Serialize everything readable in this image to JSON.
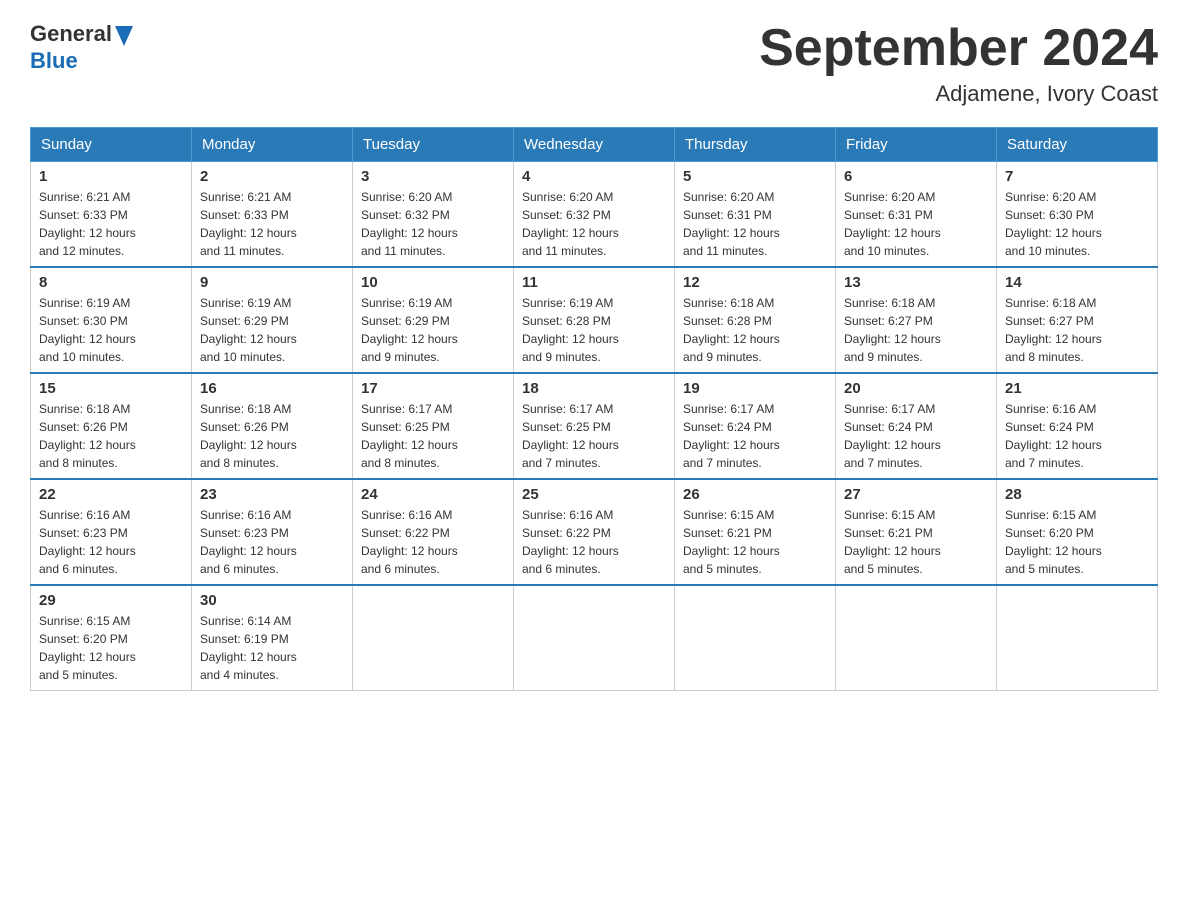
{
  "header": {
    "logo_line1": "General",
    "logo_line2": "Blue",
    "title": "September 2024",
    "subtitle": "Adjamene, Ivory Coast"
  },
  "days_of_week": [
    "Sunday",
    "Monday",
    "Tuesday",
    "Wednesday",
    "Thursday",
    "Friday",
    "Saturday"
  ],
  "weeks": [
    [
      {
        "day": "1",
        "info": "Sunrise: 6:21 AM\nSunset: 6:33 PM\nDaylight: 12 hours\nand 12 minutes."
      },
      {
        "day": "2",
        "info": "Sunrise: 6:21 AM\nSunset: 6:33 PM\nDaylight: 12 hours\nand 11 minutes."
      },
      {
        "day": "3",
        "info": "Sunrise: 6:20 AM\nSunset: 6:32 PM\nDaylight: 12 hours\nand 11 minutes."
      },
      {
        "day": "4",
        "info": "Sunrise: 6:20 AM\nSunset: 6:32 PM\nDaylight: 12 hours\nand 11 minutes."
      },
      {
        "day": "5",
        "info": "Sunrise: 6:20 AM\nSunset: 6:31 PM\nDaylight: 12 hours\nand 11 minutes."
      },
      {
        "day": "6",
        "info": "Sunrise: 6:20 AM\nSunset: 6:31 PM\nDaylight: 12 hours\nand 10 minutes."
      },
      {
        "day": "7",
        "info": "Sunrise: 6:20 AM\nSunset: 6:30 PM\nDaylight: 12 hours\nand 10 minutes."
      }
    ],
    [
      {
        "day": "8",
        "info": "Sunrise: 6:19 AM\nSunset: 6:30 PM\nDaylight: 12 hours\nand 10 minutes."
      },
      {
        "day": "9",
        "info": "Sunrise: 6:19 AM\nSunset: 6:29 PM\nDaylight: 12 hours\nand 10 minutes."
      },
      {
        "day": "10",
        "info": "Sunrise: 6:19 AM\nSunset: 6:29 PM\nDaylight: 12 hours\nand 9 minutes."
      },
      {
        "day": "11",
        "info": "Sunrise: 6:19 AM\nSunset: 6:28 PM\nDaylight: 12 hours\nand 9 minutes."
      },
      {
        "day": "12",
        "info": "Sunrise: 6:18 AM\nSunset: 6:28 PM\nDaylight: 12 hours\nand 9 minutes."
      },
      {
        "day": "13",
        "info": "Sunrise: 6:18 AM\nSunset: 6:27 PM\nDaylight: 12 hours\nand 9 minutes."
      },
      {
        "day": "14",
        "info": "Sunrise: 6:18 AM\nSunset: 6:27 PM\nDaylight: 12 hours\nand 8 minutes."
      }
    ],
    [
      {
        "day": "15",
        "info": "Sunrise: 6:18 AM\nSunset: 6:26 PM\nDaylight: 12 hours\nand 8 minutes."
      },
      {
        "day": "16",
        "info": "Sunrise: 6:18 AM\nSunset: 6:26 PM\nDaylight: 12 hours\nand 8 minutes."
      },
      {
        "day": "17",
        "info": "Sunrise: 6:17 AM\nSunset: 6:25 PM\nDaylight: 12 hours\nand 8 minutes."
      },
      {
        "day": "18",
        "info": "Sunrise: 6:17 AM\nSunset: 6:25 PM\nDaylight: 12 hours\nand 7 minutes."
      },
      {
        "day": "19",
        "info": "Sunrise: 6:17 AM\nSunset: 6:24 PM\nDaylight: 12 hours\nand 7 minutes."
      },
      {
        "day": "20",
        "info": "Sunrise: 6:17 AM\nSunset: 6:24 PM\nDaylight: 12 hours\nand 7 minutes."
      },
      {
        "day": "21",
        "info": "Sunrise: 6:16 AM\nSunset: 6:24 PM\nDaylight: 12 hours\nand 7 minutes."
      }
    ],
    [
      {
        "day": "22",
        "info": "Sunrise: 6:16 AM\nSunset: 6:23 PM\nDaylight: 12 hours\nand 6 minutes."
      },
      {
        "day": "23",
        "info": "Sunrise: 6:16 AM\nSunset: 6:23 PM\nDaylight: 12 hours\nand 6 minutes."
      },
      {
        "day": "24",
        "info": "Sunrise: 6:16 AM\nSunset: 6:22 PM\nDaylight: 12 hours\nand 6 minutes."
      },
      {
        "day": "25",
        "info": "Sunrise: 6:16 AM\nSunset: 6:22 PM\nDaylight: 12 hours\nand 6 minutes."
      },
      {
        "day": "26",
        "info": "Sunrise: 6:15 AM\nSunset: 6:21 PM\nDaylight: 12 hours\nand 5 minutes."
      },
      {
        "day": "27",
        "info": "Sunrise: 6:15 AM\nSunset: 6:21 PM\nDaylight: 12 hours\nand 5 minutes."
      },
      {
        "day": "28",
        "info": "Sunrise: 6:15 AM\nSunset: 6:20 PM\nDaylight: 12 hours\nand 5 minutes."
      }
    ],
    [
      {
        "day": "29",
        "info": "Sunrise: 6:15 AM\nSunset: 6:20 PM\nDaylight: 12 hours\nand 5 minutes."
      },
      {
        "day": "30",
        "info": "Sunrise: 6:14 AM\nSunset: 6:19 PM\nDaylight: 12 hours\nand 4 minutes."
      },
      {
        "day": "",
        "info": ""
      },
      {
        "day": "",
        "info": ""
      },
      {
        "day": "",
        "info": ""
      },
      {
        "day": "",
        "info": ""
      },
      {
        "day": "",
        "info": ""
      }
    ]
  ]
}
